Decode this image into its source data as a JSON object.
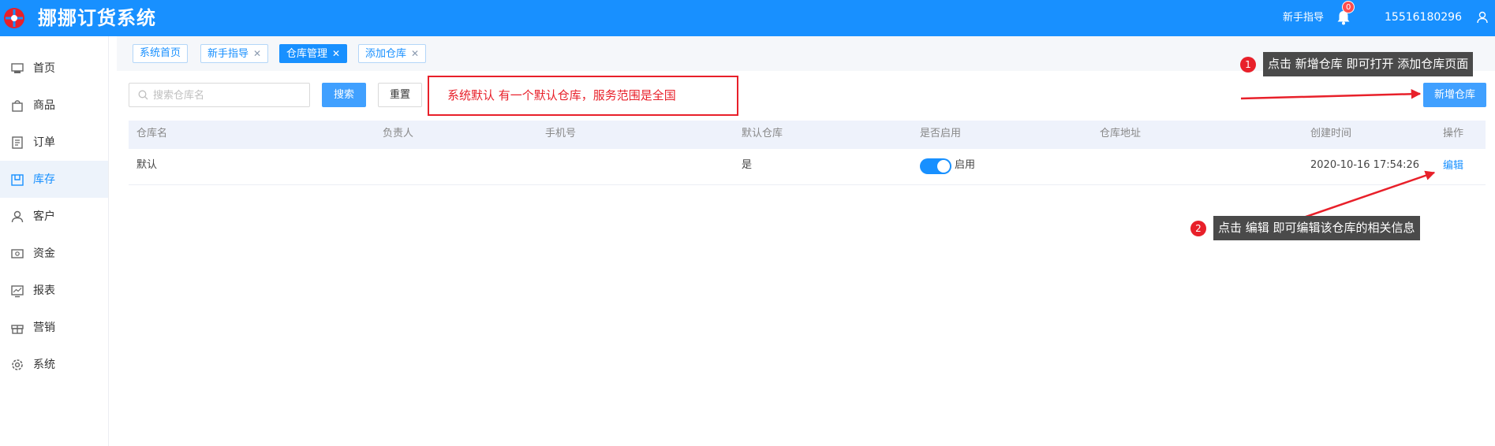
{
  "header": {
    "app_title": "挪挪订货系统",
    "guide_link": "新手指导",
    "notification_count": "0",
    "user_phone": "15516180296"
  },
  "sidebar": {
    "items": [
      {
        "label": "首页",
        "icon": "home-icon"
      },
      {
        "label": "商品",
        "icon": "shopping-bag-icon"
      },
      {
        "label": "订单",
        "icon": "order-document-icon"
      },
      {
        "label": "库存",
        "icon": "inventory-box-icon",
        "active": true
      },
      {
        "label": "客户",
        "icon": "user-icon"
      },
      {
        "label": "资金",
        "icon": "wallet-icon"
      },
      {
        "label": "报表",
        "icon": "chart-icon"
      },
      {
        "label": "营销",
        "icon": "gift-icon"
      },
      {
        "label": "系统",
        "icon": "gear-icon"
      }
    ]
  },
  "tabs": [
    {
      "label": "系统首页",
      "closable": false
    },
    {
      "label": "新手指导",
      "closable": true
    },
    {
      "label": "仓库管理",
      "closable": true,
      "active": true
    },
    {
      "label": "添加仓库",
      "closable": true
    }
  ],
  "toolbar": {
    "search_placeholder": "搜索仓库名",
    "search_label": "搜索",
    "reset_label": "重置",
    "add_label": "新增仓库"
  },
  "notice": "系统默认 有一个默认仓库，服务范围是全国",
  "table": {
    "columns": [
      "仓库名",
      "负责人",
      "手机号",
      "默认仓库",
      "是否启用",
      "仓库地址",
      "创建时间",
      "操作"
    ],
    "rows": [
      {
        "name": "默认",
        "manager": "",
        "phone": "",
        "is_default": "是",
        "enabled": true,
        "enabled_label": "启用",
        "address": "",
        "created_at": "2020-10-16 17:54:26",
        "action": "编辑"
      }
    ]
  },
  "annotations": [
    {
      "number": "1",
      "text": "点击 新增仓库 即可打开 添加仓库页面"
    },
    {
      "number": "2",
      "text": "点击 编辑 即可编辑该仓库的相关信息"
    }
  ],
  "colors": {
    "brand": "#1890ff",
    "annotation_red": "#e8202a",
    "tooltip_bg": "#4a4a4a"
  }
}
